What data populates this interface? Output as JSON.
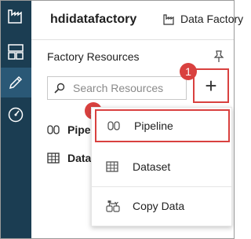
{
  "header": {
    "factory_name": "hdidatafactory",
    "tab_label": "Data Factory"
  },
  "nav_rail": {
    "items": [
      {
        "icon": "data-factory-icon",
        "active": false
      },
      {
        "icon": "dashboard-icon",
        "active": false
      },
      {
        "icon": "pencil-icon",
        "active": true
      },
      {
        "icon": "monitor-icon",
        "active": false
      }
    ]
  },
  "resources_panel": {
    "title": "Factory Resources",
    "search": {
      "placeholder": "Search Resources",
      "value": ""
    },
    "add_label": "+",
    "items": [
      {
        "label": "Pipelines",
        "icon": "pipeline-icon"
      },
      {
        "label": "Datasets",
        "icon": "dataset-icon"
      }
    ]
  },
  "dropdown_menu": {
    "items": [
      {
        "label": "Pipeline",
        "icon": "pipeline-icon",
        "highlighted": true
      },
      {
        "label": "Dataset",
        "icon": "dataset-icon",
        "highlighted": false
      },
      {
        "label": "Copy Data",
        "icon": "copy-data-icon",
        "highlighted": false
      }
    ]
  },
  "callouts": [
    "1",
    "2"
  ],
  "colors": {
    "nav_bg": "#1b3d52",
    "nav_active": "#2a5876",
    "highlight": "#d9413f"
  }
}
